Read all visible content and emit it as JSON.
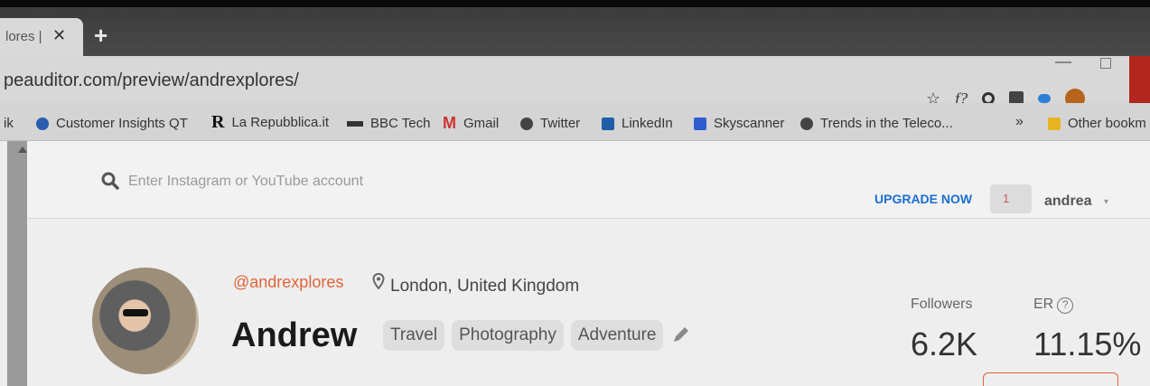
{
  "browser": {
    "tab_title": "lores |",
    "tab_close": "✕",
    "new_tab": "+",
    "url": "peauditor.com/preview/andrexplores/",
    "toolbar": {
      "star": "☆",
      "fx": "f?"
    }
  },
  "bookmarks": [
    {
      "label": "ik"
    },
    {
      "label": "Customer Insights QT"
    },
    {
      "label": "La Repubblica.it",
      "icon_text": "R"
    },
    {
      "label": "BBC Tech"
    },
    {
      "label": "Gmail",
      "icon_text": "M"
    },
    {
      "label": "Twitter"
    },
    {
      "label": "LinkedIn",
      "icon_text": "in"
    },
    {
      "label": "Skyscanner"
    },
    {
      "label": "Trends in the Teleco..."
    }
  ],
  "bookmarks_overflow": "»",
  "other_bookmarks": "Other bookm",
  "header": {
    "search_placeholder": "Enter Instagram or YouTube account",
    "upgrade": "UPGRADE NOW",
    "notifications": "1",
    "username": "andrea",
    "user_chevron": "▾"
  },
  "profile": {
    "handle": "@andrexplores",
    "location": "London, United Kingdom",
    "name": "Andrew",
    "tags": [
      "Travel",
      "Photography",
      "Adventure"
    ],
    "followers_label": "Followers",
    "followers_value": "6.2K",
    "er_label": "ER",
    "er_help": "?",
    "er_value": "11.15%"
  },
  "colors": {
    "accent": "#e0643a",
    "upgrade": "#1b6fd1"
  }
}
